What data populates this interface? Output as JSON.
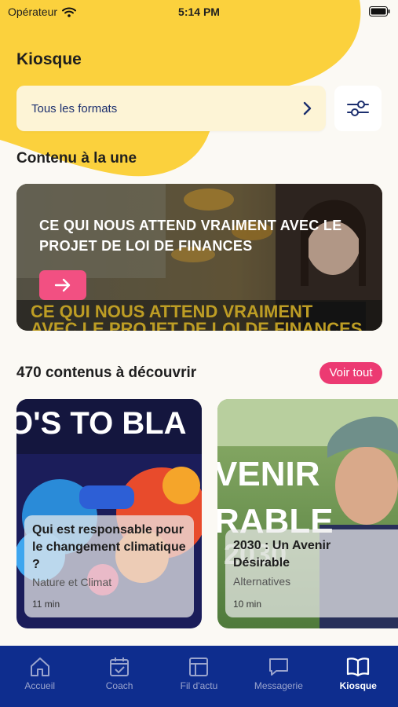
{
  "status_bar": {
    "carrier": "Opérateur",
    "time": "5:14 PM"
  },
  "header": {
    "title": "Kiosque"
  },
  "format_filter": {
    "label": "Tous les formats"
  },
  "featured": {
    "section_title": "Contenu à la une",
    "title": "CE QUI NOUS ATTEND VRAIMENT AVEC LE PROJET DE LOI DE FINANCES",
    "thumb_caption_line1": "CE QUI NOUS ATTEND VRAIMENT",
    "thumb_caption_line2": "AVEC LE PROJET DE LOI DE FINANCES"
  },
  "discover": {
    "title": "470 contenus à découvrir",
    "see_all_label": "Voir tout",
    "cards": [
      {
        "thumb_text": "O'S TO BLA",
        "title": "Qui est responsable pour le changement climatique ?",
        "category": "Nature et Climat",
        "duration": "11 min"
      },
      {
        "thumb_text_1": "VENIR",
        "thumb_text_2": "RABLE",
        "thumb_text_3": "2030",
        "title": "2030 : Un Avenir Désirable",
        "category": "Alternatives",
        "duration": "10 min"
      }
    ]
  },
  "tabbar": {
    "items": [
      {
        "label": "Accueil",
        "icon": "home-icon"
      },
      {
        "label": "Coach",
        "icon": "calendar-check-icon"
      },
      {
        "label": "Fil d'actu",
        "icon": "feed-icon"
      },
      {
        "label": "Messagerie",
        "icon": "chat-icon"
      },
      {
        "label": "Kiosque",
        "icon": "book-icon",
        "active": true
      }
    ]
  },
  "colors": {
    "accent_yellow": "#fbd13d",
    "accent_pink": "#ec3a72",
    "tabbar_blue": "#0e2d8e"
  }
}
